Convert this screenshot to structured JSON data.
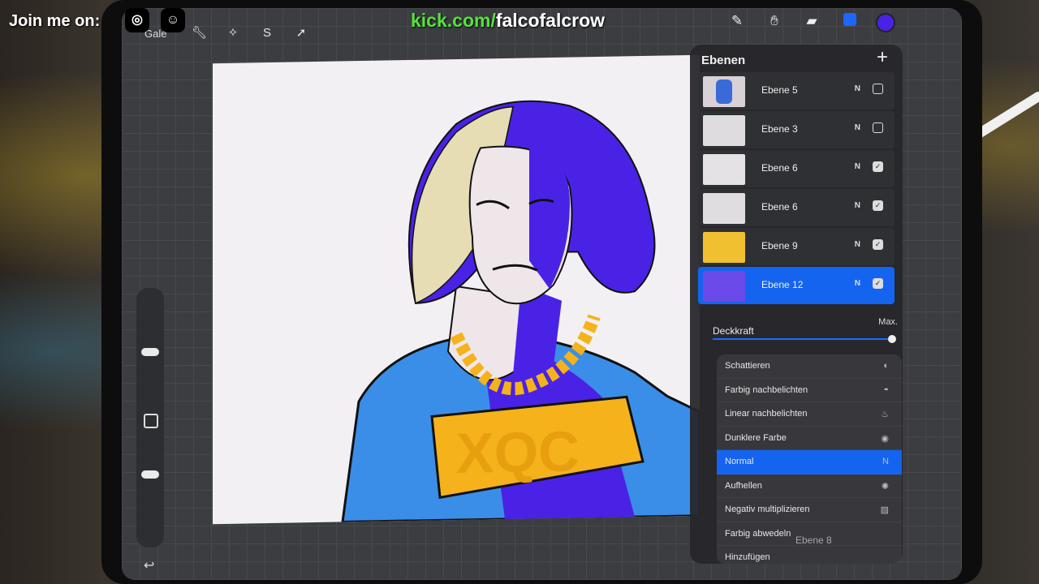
{
  "overlay": {
    "join_text": "Join me on:",
    "instagram_icon": "instagram-icon",
    "discord_icon": "discord-icon",
    "kick_domain": "kick.com/",
    "kick_user": "falcofalcrow",
    "accent_green": "#54e43a"
  },
  "toolbar": {
    "gallery_label": "Gale",
    "left_tools": [
      "wrench-icon",
      "magic-wand-icon",
      "selection-icon",
      "transform-arrow-icon"
    ],
    "right_tools": [
      "brush-icon",
      "smudge-icon",
      "eraser-icon",
      "layers-icon"
    ],
    "current_color": "#4a22e6"
  },
  "layers_panel": {
    "title": "Ebenen",
    "add_symbol": "+",
    "layers": [
      {
        "name": "Ebene 5",
        "mode": "N",
        "visible": false
      },
      {
        "name": "Ebene 3",
        "mode": "N",
        "visible": false
      },
      {
        "name": "Ebene 6",
        "mode": "N",
        "visible": true
      },
      {
        "name": "Ebene 6",
        "mode": "N",
        "visible": true
      },
      {
        "name": "Ebene 9",
        "mode": "N",
        "visible": true
      },
      {
        "name": "Ebene 12",
        "mode": "N",
        "visible": true,
        "selected": true
      }
    ],
    "opacity_label": "Deckkraft",
    "opacity_value": "Max.",
    "blend_modes": [
      {
        "label": "Schattieren",
        "icon": "◐"
      },
      {
        "label": "Farbig nachbelichten",
        "icon": "◓"
      },
      {
        "label": "Linear nachbelichten",
        "icon": "♨"
      },
      {
        "label": "Dunklere Farbe",
        "icon": "◉"
      },
      {
        "label": "Normal",
        "icon": "N",
        "selected": true
      },
      {
        "label": "Aufhellen",
        "icon": "✺"
      },
      {
        "label": "Negativ multiplizieren",
        "icon": "▨"
      },
      {
        "label": "Farbig abwedeln",
        "icon": ""
      },
      {
        "label": "Hinzufügen",
        "icon": ""
      }
    ],
    "ghost_layer": "Ebene 8",
    "selected_color": "#1464f0"
  }
}
